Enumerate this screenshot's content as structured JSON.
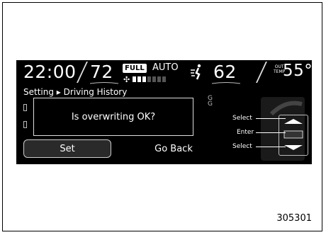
{
  "status": {
    "clock": "22:00",
    "driver_temp": "72",
    "full_badge": "FULL",
    "mode": "AUTO",
    "fan_levels_on": 3,
    "fan_levels_total": 7,
    "passenger_temp": "62",
    "out_label_1": "OUT",
    "out_label_2": "TEMP",
    "outside_temp": "55°F"
  },
  "breadcrumb": {
    "root": "Setting",
    "separator": "▸",
    "page": "Driving History"
  },
  "partial_label": "G G",
  "dialog": {
    "message": "Is overwriting OK?"
  },
  "buttons": {
    "set": "Set",
    "go_back": "Go Back"
  },
  "controls": {
    "select_up": "Select",
    "enter": "Enter",
    "select_down": "Select"
  },
  "caption": "305301"
}
